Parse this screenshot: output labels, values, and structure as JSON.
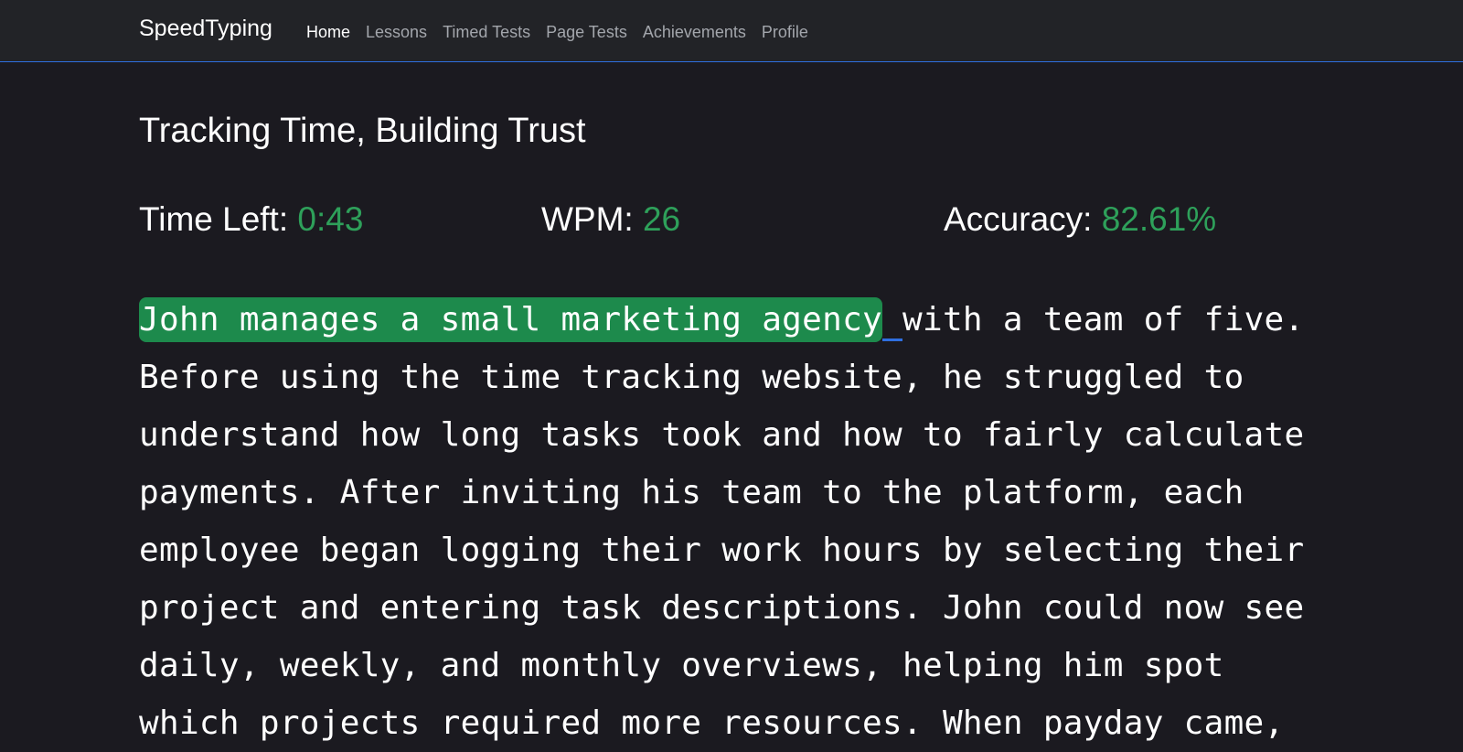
{
  "nav": {
    "brand": "SpeedTyping",
    "links": [
      {
        "label": "Home",
        "active": true
      },
      {
        "label": "Lessons",
        "active": false
      },
      {
        "label": "Timed Tests",
        "active": false
      },
      {
        "label": "Page Tests",
        "active": false
      },
      {
        "label": "Achievements",
        "active": false
      },
      {
        "label": "Profile",
        "active": false
      }
    ]
  },
  "test": {
    "title": "Tracking Time, Building Trust",
    "stats": {
      "time_label": "Time Left: ",
      "time_value": "0:43",
      "wpm_label": "WPM: ",
      "wpm_value": "26",
      "accuracy_label": "Accuracy: ",
      "accuracy_value": "82.61%"
    },
    "passage": {
      "typed": "John manages a small marketing agency",
      "current": " ",
      "remaining": "with a team of five. Before using the time tracking website, he struggled to understand how long tasks took and how to fairly calculate payments. After inviting his team to the platform, each employee began logging their work hours by selecting their project and entering task descriptions. John could now see daily, weekly, and monthly overviews, helping him spot which projects required more resources. When payday came,"
    }
  },
  "colors": {
    "background": "#1b1a20",
    "navbar": "#222327",
    "accent": "#2f6fe0",
    "success": "#2ea05a",
    "typed_highlight": "#1d8a4c"
  }
}
